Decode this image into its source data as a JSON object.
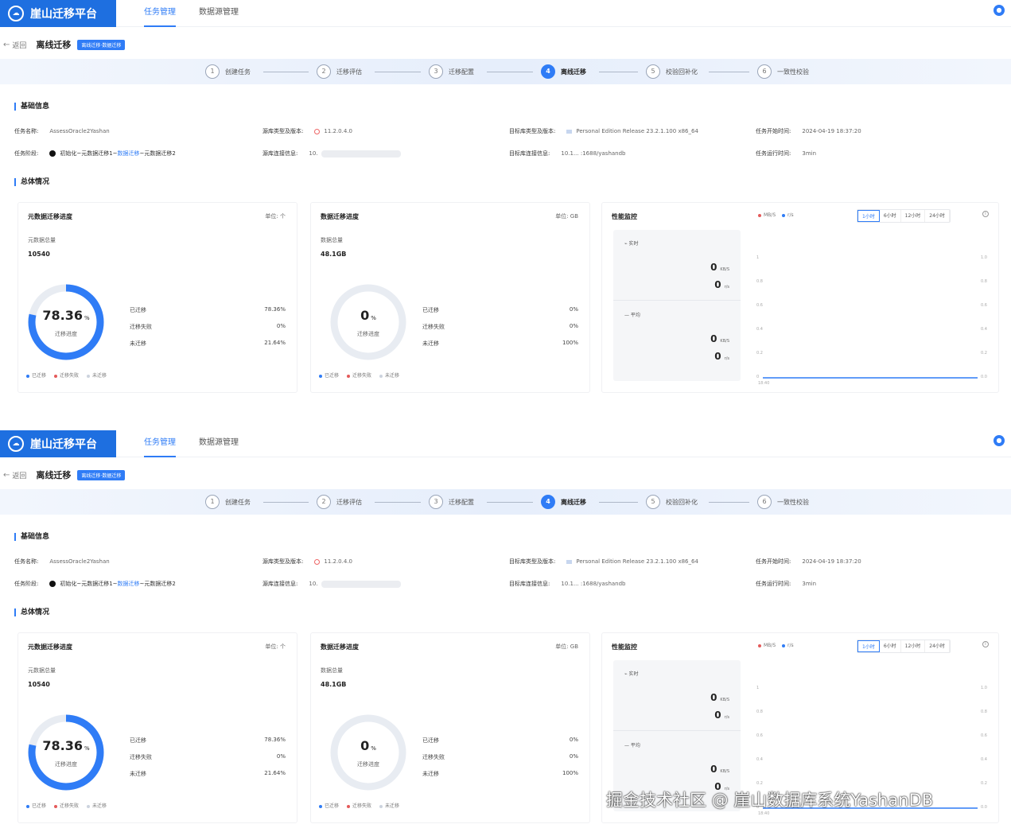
{
  "panels": [
    {
      "header": {
        "brand": "崖山迁移平台",
        "nav_task": "任务管理",
        "nav_datasource": "数据源管理"
      },
      "titlebar": {
        "back": "返回",
        "title": "离线迁移",
        "tag": "离线迁移·数据迁移"
      },
      "steps": [
        "创建任务",
        "迁移评估",
        "迁移配置",
        "离线迁移",
        "校验回补化",
        "一致性校验"
      ],
      "step_numbers": [
        "1",
        "2",
        "3",
        "4",
        "5",
        "6"
      ],
      "basic": {
        "section_title": "基础信息",
        "task_name_label": "任务名称:",
        "task_name": "AssessOracle2Yashan",
        "task_phase_label": "任务阶段:",
        "phase_part1": "初始化~元数据迁移1~",
        "phase_link": "数据迁移",
        "phase_part2": "~元数据迁移2",
        "src_type_label": "源库类型及版本:",
        "src_version": "11.2.0.4.0",
        "src_conn_label": "源库连接信息:",
        "src_conn": "10.",
        "tgt_type_label": "目标库类型及版本:",
        "tgt_version": "Personal Edition Release 23.2.1.100 x86_64",
        "tgt_conn_label": "目标库连接信息:",
        "tgt_conn": "10.1...   :1688/yashandb",
        "start_label": "任务开始时间:",
        "start": "2024-04-19 18:37:20",
        "duration_label": "任务运行时间:",
        "duration": "3min"
      },
      "overview_title": "总体情况",
      "meta": {
        "title": "元数据迁移进度",
        "unit": "单位: 个",
        "sub": "元数据总量",
        "total": "10540",
        "percent": "78.36",
        "pct_sign": "%",
        "center_label": "迁移进度",
        "rows": [
          {
            "label": "已迁移",
            "value": "78.36%"
          },
          {
            "label": "迁移失败",
            "value": "0%"
          },
          {
            "label": "未迁移",
            "value": "21.64%"
          }
        ],
        "legend": [
          "已迁移",
          "迁移失败",
          "未迁移"
        ],
        "progress": 0.7836
      },
      "data": {
        "title": "数据迁移进度",
        "unit": "单位: GB",
        "sub": "数据总量",
        "total": "48.1GB",
        "percent": "0",
        "pct_sign": "%",
        "center_label": "迁移进度",
        "rows": [
          {
            "label": "已迁移",
            "value": "0%"
          },
          {
            "label": "迁移失败",
            "value": "0%"
          },
          {
            "label": "未迁移",
            "value": "100%"
          }
        ],
        "legend": [
          "已迁移",
          "迁移失败",
          "未迁移"
        ],
        "progress": 0
      },
      "perf": {
        "title": "性能监控",
        "realtime": "实时",
        "average": "平均",
        "v1": "0",
        "u1": "KB/S",
        "v2": "0",
        "u2": "r/s",
        "v3": "0",
        "u3": "KB/S",
        "v4": "0",
        "u4": "r/s",
        "legend": [
          "MB/S",
          "r/s"
        ],
        "ranges": [
          "1小时",
          "6小时",
          "12小时",
          "24小时"
        ],
        "y_left": [
          "1",
          "0.8",
          "0.6",
          "0.4",
          "0.2",
          "0"
        ],
        "y_right": [
          "1.0",
          "0.8",
          "0.6",
          "0.4",
          "0.2",
          "0.0"
        ],
        "x_tick": "18:40"
      }
    },
    {
      "header": {
        "brand": "崖山迁移平台",
        "nav_task": "任务管理",
        "nav_datasource": "数据源管理"
      },
      "titlebar": {
        "back": "返回",
        "title": "离线迁移",
        "tag": "离线迁移·数据迁移"
      },
      "steps": [
        "创建任务",
        "迁移评估",
        "迁移配置",
        "离线迁移",
        "校验回补化",
        "一致性校验"
      ],
      "step_numbers": [
        "1",
        "2",
        "3",
        "4",
        "5",
        "6"
      ],
      "basic": {
        "section_title": "基础信息",
        "task_name_label": "任务名称:",
        "task_name": "AssessOracle2Yashan",
        "task_phase_label": "任务阶段:",
        "phase_part1": "初始化~元数据迁移1~",
        "phase_link": "数据迁移",
        "phase_part2": "~元数据迁移2",
        "src_type_label": "源库类型及版本:",
        "src_version": "11.2.0.4.0",
        "src_conn_label": "源库连接信息:",
        "src_conn": "10.",
        "tgt_type_label": "目标库类型及版本:",
        "tgt_version": "Personal Edition Release 23.2.1.100 x86_64",
        "tgt_conn_label": "目标库连接信息:",
        "tgt_conn": "10.1...   :1688/yashandb",
        "start_label": "任务开始时间:",
        "start": "2024-04-19 18:37:20",
        "duration_label": "任务运行时间:",
        "duration": "3min"
      },
      "overview_title": "总体情况",
      "meta": {
        "title": "元数据迁移进度",
        "unit": "单位: 个",
        "sub": "元数据总量",
        "total": "10540",
        "percent": "78.36",
        "pct_sign": "%",
        "center_label": "迁移进度",
        "rows": [
          {
            "label": "已迁移",
            "value": "78.36%"
          },
          {
            "label": "迁移失败",
            "value": "0%"
          },
          {
            "label": "未迁移",
            "value": "21.64%"
          }
        ],
        "legend": [
          "已迁移",
          "迁移失败",
          "未迁移"
        ],
        "progress": 0.7836
      },
      "data": {
        "title": "数据迁移进度",
        "unit": "单位: GB",
        "sub": "数据总量",
        "total": "48.1GB",
        "percent": "0",
        "pct_sign": "%",
        "center_label": "迁移进度",
        "rows": [
          {
            "label": "已迁移",
            "value": "0%"
          },
          {
            "label": "迁移失败",
            "value": "0%"
          },
          {
            "label": "未迁移",
            "value": "100%"
          }
        ],
        "legend": [
          "已迁移",
          "迁移失败",
          "未迁移"
        ],
        "progress": 0
      },
      "perf": {
        "title": "性能监控",
        "realtime": "实时",
        "average": "平均",
        "v1": "0",
        "u1": "KB/S",
        "v2": "0",
        "u2": "r/s",
        "v3": "0",
        "u3": "KB/S",
        "v4": "0",
        "u4": "r/s",
        "legend": [
          "MB/S",
          "r/s"
        ],
        "ranges": [
          "1小时",
          "6小时",
          "12小时",
          "24小时"
        ],
        "y_left": [
          "1",
          "0.8",
          "0.6",
          "0.4",
          "0.2",
          "0"
        ],
        "y_right": [
          "1.0",
          "0.8",
          "0.6",
          "0.4",
          "0.2",
          "0.0"
        ],
        "x_tick": "18:40"
      }
    }
  ],
  "colors": {
    "primary": "#2f7cf6",
    "brand": "#1e6fe0",
    "fail": "#e45a5a",
    "pending": "#e8ecf2"
  },
  "watermark": "掘金技术社区 @ 崖山数据库系统YashanDB"
}
